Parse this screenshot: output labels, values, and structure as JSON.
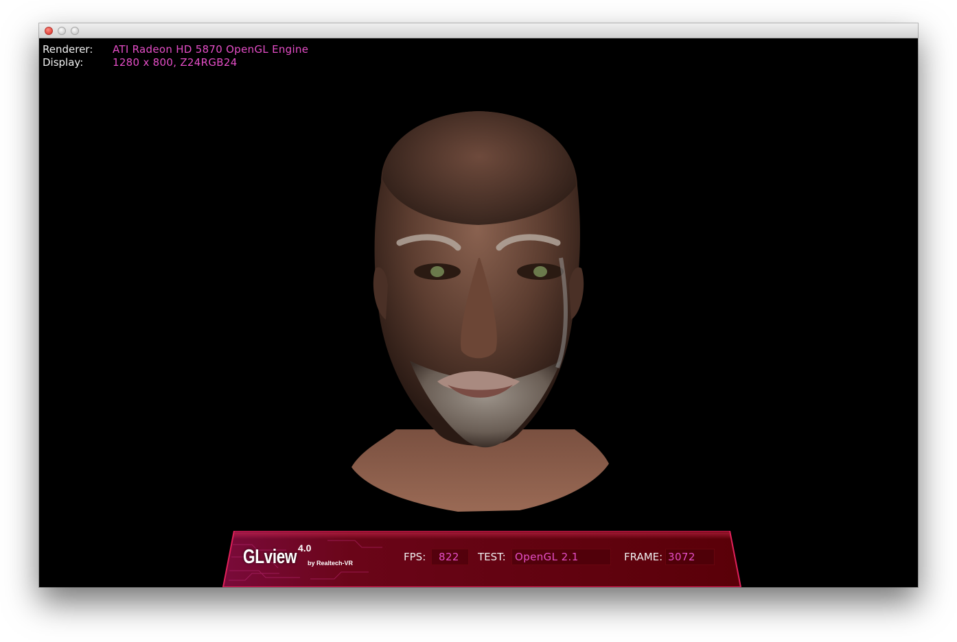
{
  "window": {
    "controls": [
      "close",
      "minimize",
      "zoom"
    ]
  },
  "info": {
    "renderer_label": "Renderer:",
    "renderer_value": "ATI Radeon HD 5870 OpenGL Engine",
    "display_label": "Display:",
    "display_value": "1280 x 800, Z24RGB24"
  },
  "hud": {
    "logo_title": "GLview",
    "logo_version": "4.0",
    "logo_byline": "by Realtech-VR",
    "fps_label": "FPS:",
    "fps_value": "822",
    "test_label": "TEST:",
    "test_value": "OpenGL 2.1",
    "frame_label": "FRAME:",
    "frame_value": "3072"
  },
  "colors": {
    "accent_magenta": "#e64ec8",
    "hud_red": "#6e0010",
    "background": "#000000"
  },
  "scene": {
    "subject": "3d-head-model"
  }
}
